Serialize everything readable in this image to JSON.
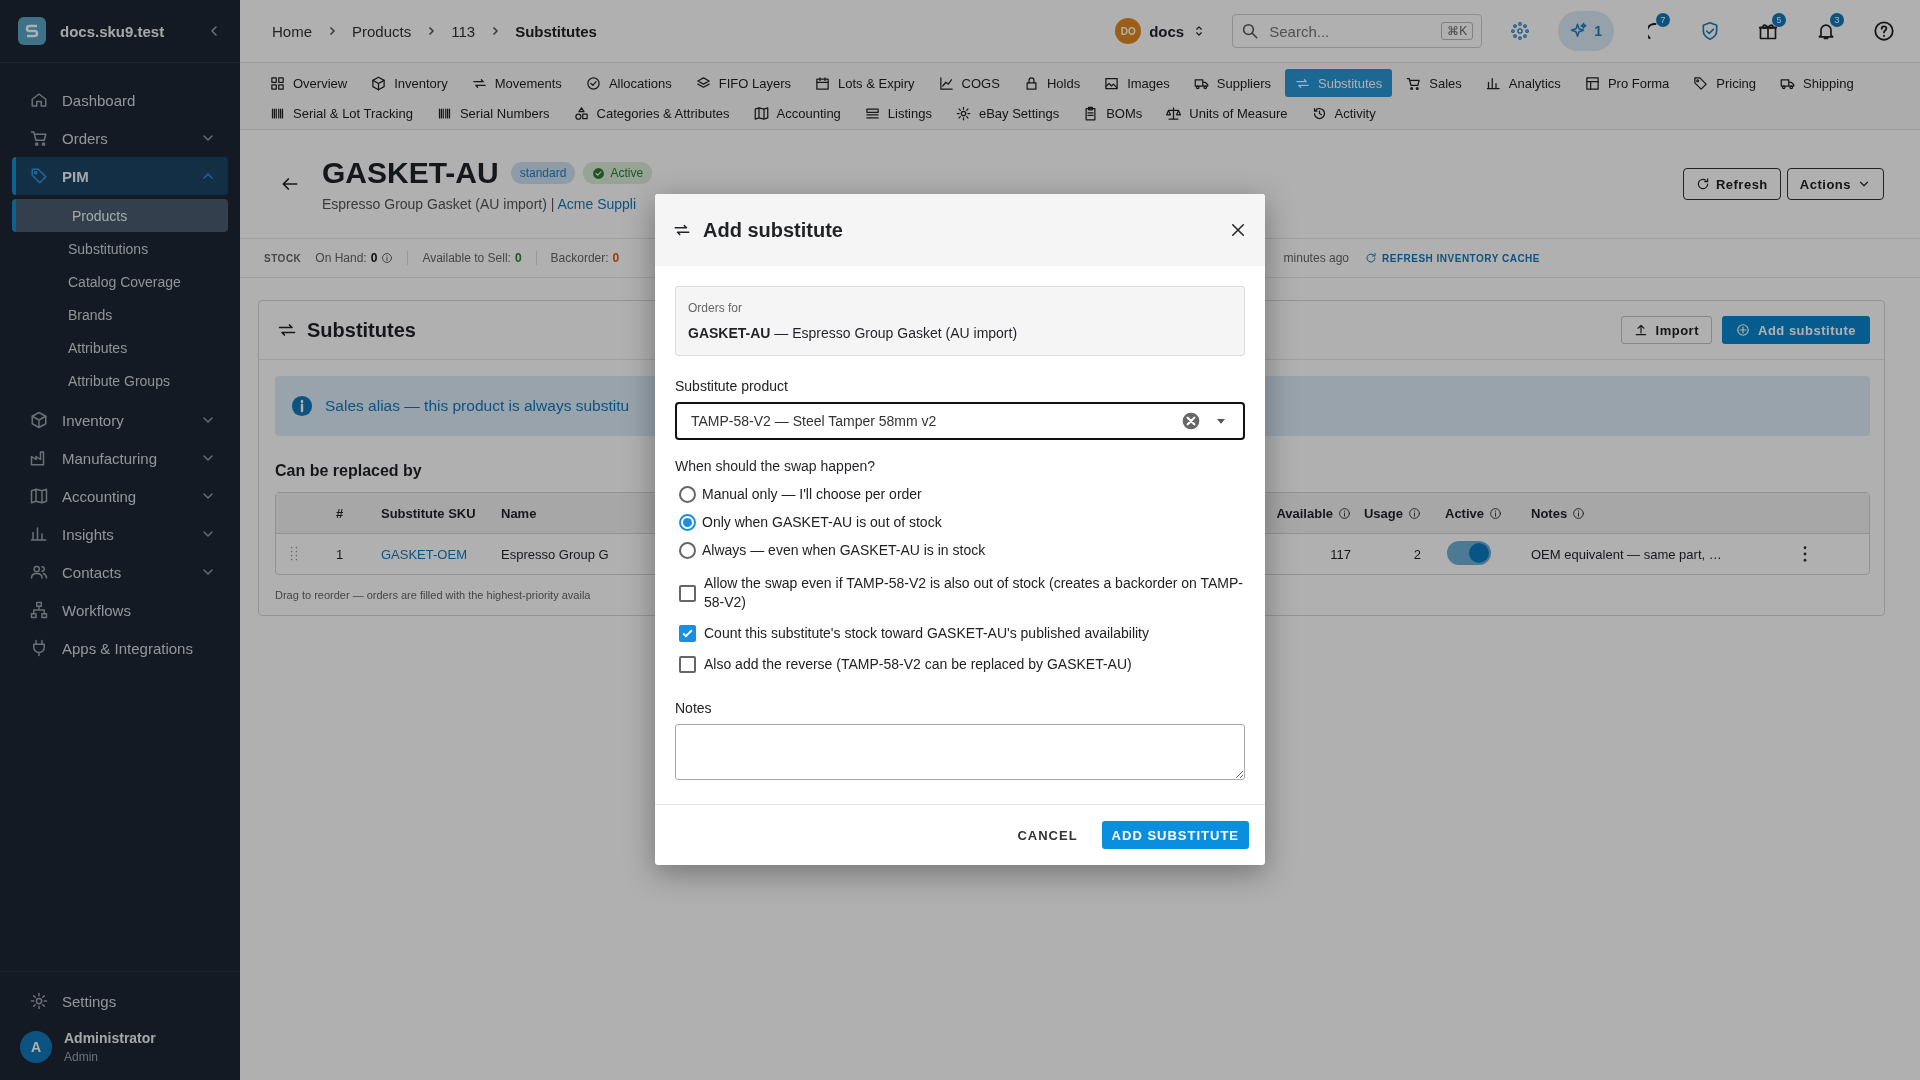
{
  "app": {
    "name": "docs.sku9.test"
  },
  "sidebar": {
    "items": [
      {
        "label": "Dashboard",
        "selected": false
      },
      {
        "label": "Orders",
        "selected": false,
        "expanded": false
      },
      {
        "label": "PIM",
        "selected": true,
        "expanded": true,
        "children": [
          {
            "label": "Products",
            "selected": true
          },
          {
            "label": "Substitutions",
            "selected": false
          },
          {
            "label": "Catalog Coverage",
            "selected": false
          },
          {
            "label": "Brands",
            "selected": false
          },
          {
            "label": "Attributes",
            "selected": false
          },
          {
            "label": "Attribute Groups",
            "selected": false
          }
        ]
      },
      {
        "label": "Inventory",
        "selected": false,
        "expanded": false
      },
      {
        "label": "Manufacturing",
        "selected": false,
        "expanded": false
      },
      {
        "label": "Accounting",
        "selected": false,
        "expanded": false
      },
      {
        "label": "Insights",
        "selected": false,
        "expanded": false
      },
      {
        "label": "Contacts",
        "selected": false,
        "expanded": false
      },
      {
        "label": "Workflows",
        "selected": false
      },
      {
        "label": "Apps & Integrations",
        "selected": false
      }
    ],
    "settings": "Settings",
    "user": {
      "initial": "A",
      "name": "Administrator",
      "role": "Admin"
    }
  },
  "breadcrumbs": [
    "Home",
    "Products",
    "113",
    "Substitutes"
  ],
  "org": {
    "initials": "DO",
    "name": "docs"
  },
  "search": {
    "placeholder": "Search...",
    "shortcut": "⌘K"
  },
  "badges": {
    "ai": "1",
    "sync": "7",
    "gifts": "5",
    "notifications": "3"
  },
  "tab_rows": [
    [
      {
        "label": "Overview",
        "selected": false
      },
      {
        "label": "Inventory",
        "selected": false
      },
      {
        "label": "Movements",
        "selected": false
      },
      {
        "label": "Allocations",
        "selected": false
      },
      {
        "label": "FIFO Layers",
        "selected": false
      },
      {
        "label": "Lots & Expiry",
        "selected": false
      },
      {
        "label": "COGS",
        "selected": false
      },
      {
        "label": "Holds",
        "selected": false
      },
      {
        "label": "Images",
        "selected": false
      },
      {
        "label": "Suppliers",
        "selected": false
      },
      {
        "label": "Substitutes",
        "selected": true
      },
      {
        "label": "Sales",
        "selected": false
      },
      {
        "label": "Analytics",
        "selected": false
      },
      {
        "label": "Pro Forma",
        "selected": false
      },
      {
        "label": "Pricing",
        "selected": false
      },
      {
        "label": "Shipping",
        "selected": false
      }
    ],
    [
      {
        "label": "Serial & Lot Tracking",
        "selected": false
      },
      {
        "label": "Serial Numbers",
        "selected": false
      },
      {
        "label": "Categories & Attributes",
        "selected": false
      },
      {
        "label": "Accounting",
        "selected": false
      },
      {
        "label": "Listings",
        "selected": false
      },
      {
        "label": "eBay Settings",
        "selected": false
      },
      {
        "label": "BOMs",
        "selected": false
      },
      {
        "label": "Units of Measure",
        "selected": false
      },
      {
        "label": "Activity",
        "selected": false
      }
    ]
  ],
  "product": {
    "sku": "GASKET-AU",
    "type": "standard",
    "status": "Active",
    "description": "Espresso Group Gasket (AU import) |",
    "supplier_link": "Acme Suppli"
  },
  "header_buttons": {
    "refresh": "Refresh",
    "actions": "Actions"
  },
  "stock": {
    "label": "STOCK",
    "items": [
      {
        "label": "On Hand:",
        "value": "0",
        "kind": "neutral",
        "info": true
      },
      {
        "label": "Available to Sell:",
        "value": "0",
        "kind": "positive",
        "info": false
      },
      {
        "label": "Backorder:",
        "value": "0",
        "kind": "warning",
        "info": false
      }
    ],
    "updated": "minutes ago",
    "refresh": "REFRESH INVENTORY CACHE"
  },
  "card": {
    "title": "Substitutes",
    "import": "Import",
    "add": "Add substitute",
    "alert": "Sales alias — this product is always substitu",
    "section": "Can be replaced by",
    "columns": [
      {
        "label": "#",
        "info": false
      },
      {
        "label": "Substitute SKU",
        "info": false
      },
      {
        "label": "Name",
        "info": false
      },
      {
        "label": "Available",
        "info": true
      },
      {
        "label": "Usage",
        "info": true
      },
      {
        "label": "Active",
        "info": true
      },
      {
        "label": "Notes",
        "info": true
      }
    ],
    "rows": [
      {
        "number": "1",
        "sku": "GASKET-OEM",
        "name": "Espresso Group G",
        "available": "117",
        "usage": "2",
        "active": true,
        "notes": "OEM equivalent — same part, …"
      }
    ],
    "footnote": "Drag to reorder — orders are filled with the highest-priority availa"
  },
  "dialog": {
    "title": "Add substitute",
    "orders_label": "Orders for",
    "orders_value": "**GASKET-AU** — Espresso Group Gasket (AU import)",
    "product_label": "Substitute product",
    "product_value": "TAMP-58-V2 — Steel Tamper 58mm v2",
    "question": "When should the swap happen?",
    "swap_options": [
      {
        "label": "Manual only — I'll choose per order",
        "selected": false
      },
      {
        "label": "Only when GASKET-AU is out of stock",
        "selected": true
      },
      {
        "label": "Always — even when GASKET-AU is in stock",
        "selected": false
      }
    ],
    "options": [
      {
        "label": "Allow the swap even if TAMP-58-V2 is also out of stock (creates a backorder on TAMP-58-V2)",
        "checked": false
      },
      {
        "label": "Count this substitute's stock toward GASKET-AU's published availability",
        "checked": true
      },
      {
        "label": "Also add the reverse (TAMP-58-V2 can be replaced by GASKET-AU)",
        "checked": false
      }
    ],
    "notes_label": "Notes",
    "cancel": "CANCEL",
    "submit": "ADD SUBSTITUTE"
  }
}
